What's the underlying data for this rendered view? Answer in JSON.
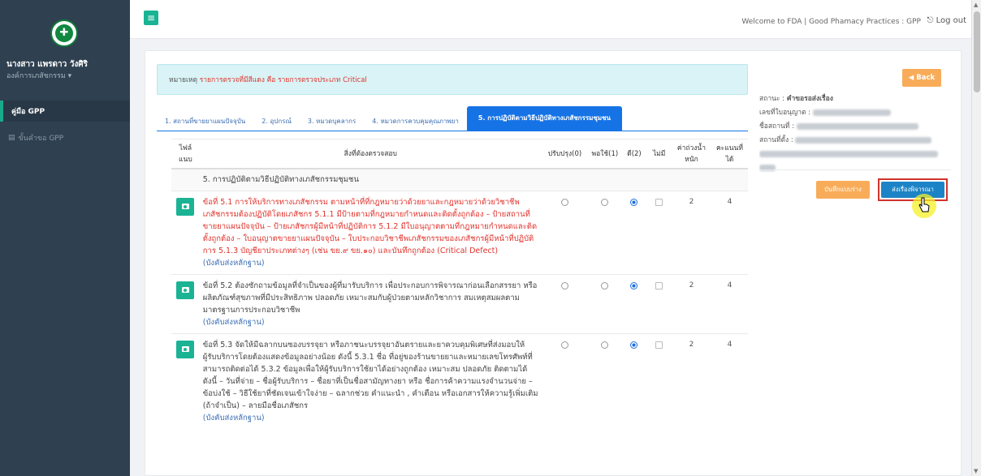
{
  "sidebar": {
    "user_name": "นางสาว แพรดาว วังศิริ",
    "user_org": "องค์การเภสัชกรรม ▾",
    "items": [
      {
        "label": "คู่มือ GPP",
        "icon": "book-icon"
      },
      {
        "label": "ขั้นคำขอ GPP",
        "icon": "file-icon"
      }
    ]
  },
  "topbar": {
    "menu_icon": "≡",
    "welcome": "Welcome to FDA | Good Phamacy Practices : GPP",
    "logout": "Log out",
    "logout_icon": "⎋"
  },
  "note": {
    "label": "หมายเหตุ",
    "text": "รายการตรวจที่มีสีแดง คือ รายการตรวจประเภท Critical"
  },
  "tabs": [
    {
      "label": "1. สถานที่ขายยาแผนปัจจุบัน",
      "active": false
    },
    {
      "label": "2. อุปกรณ์",
      "active": false
    },
    {
      "label": "3. หมวดบุคลากร",
      "active": false
    },
    {
      "label": "4. หมวดการควบคุมคุณภาพยา",
      "active": false
    },
    {
      "label": "5. การปฏิบัติตามวิธีปฏิบัติทางเภสัชกรรมชุมชน",
      "active": true
    }
  ],
  "table": {
    "headers": {
      "attach": "ไฟล์แนบ",
      "item": "สิ่งที่ต้องตรวจสอบ",
      "improve": "ปรับปรุง(0)",
      "fair": "พอใช้(1)",
      "good": "ดี(2)",
      "na": "ไม่มี",
      "weight": "ค่าถ่วงน้ำหนัก",
      "score": "คะแนนที่ได้"
    },
    "section": "5. การปฏิบัติตามวิธีปฏิบัติทางเภสัชกรรมชุมชน",
    "rows": [
      {
        "text": "ข้อที่ 5.1 การให้บริการทางเภสัชกรรม ตามหน้าที่ที่กฎหมายว่าด้วยยาและกฎหมายว่าด้วยวิชาชีพเภสัชกรรมต้องปฏิบัติโดยเภสัชกร 5.1.1 มีป้ายตามที่กฎหมายกำหนดและติดตั้งถูกต้อง – ป้ายสถานที่ขายยาแผนปัจจุบัน – ป้ายเภสัชกรผู้มีหน้าที่ปฏิบัติการ 5.1.2 มีใบอนุญาตตามที่กฎหมายกำหนดและติดตั้งถูกต้อง – ใบอนุญาตขายยาแผนปัจจุบัน – ใบประกอบวิชาชีพเภสัชกรรมของเภสัชกรผู้มีหน้าที่ปฏิบัติการ 5.1.3 บัญชียาประเภทต่างๆ (เช่น ขย.๙ ขย.๑๐) และบันทึกถูกต้อง (Critical Defect)",
        "required": "(บังคับส่งหลักฐาน)",
        "critical": true,
        "selected": "good",
        "weight": "2",
        "score": "4"
      },
      {
        "text": "ข้อที่ 5.2 ต้องซักถามข้อมูลที่จำเป็นของผู้ที่มารับบริการ เพื่อประกอบการพิจารณาก่อนเลือกสรรยา หรือผลิตภัณฑ์สุขภาพที่มีประสิทธิภาพ ปลอดภัย เหมาะสมกับผู้ป่วยตามหลักวิชาการ สมเหตุสมผลตามมาตรฐานการประกอบวิชาชีพ",
        "required": "(บังคับส่งหลักฐาน)",
        "critical": false,
        "selected": "good",
        "weight": "2",
        "score": "4"
      },
      {
        "text": "ข้อที่ 5.3 จัดให้มีฉลากบนซองบรรจุยา หรือภาชนะบรรจุยาอันตรายและยาควบคุมพิเศษที่ส่งมอบให้ผู้รับบริการโดยต้องแสดงข้อมูลอย่างน้อย ดังนี้ 5.3.1 ชื่อ ที่อยู่ของร้านขายยาและหมายเลขโทรศัพท์ที่สามารถติดต่อได้ 5.3.2 ข้อมูลเพื่อให้ผู้รับบริการใช้ยาได้อย่างถูกต้อง เหมาะสม ปลอดภัย ติดตามได้ดังนี้ – วันที่จ่าย – ชื่อผู้รับบริการ – ชื่อยาที่เป็นชื่อสามัญทางยา หรือ ชื่อการค้าความแรงจำนวนจ่าย – ข้อบ่งใช้ – วิธีใช้ยาที่ชัดเจนเข้าใจง่าย – ฉลากช่วย คำแนะนำ , คำเตือน หรือเอกสารให้ความรู้เพิ่มเติม (ถ้าจำเป็น) – ลายมือชื่อเภสัชกร",
        "required": "(บังคับส่งหลักฐาน)",
        "critical": false,
        "selected": "good",
        "weight": "2",
        "score": "4"
      }
    ]
  },
  "side": {
    "back_label": "Back",
    "back_icon": "circle-left-icon",
    "status_label": "สถานะ :",
    "status_value": "คำขอรอส่งเรื่อง",
    "license_label": "เลขที่ใบอนุญาต :",
    "place_label": "ชื่อสถานที่ :",
    "address_label": "สถานที่ตั้ง :",
    "draft_label": "บันทึกแบบร่าง",
    "submit_label": "ส่งเรื่องพิจารณา"
  },
  "colors": {
    "sidebar_bg": "#2f4050",
    "accent_green": "#1ab394",
    "tab_blue": "#1673e6",
    "critical_red": "#e0332c",
    "warning_orange": "#f8ac59",
    "submit_blue": "#1c84c6"
  }
}
